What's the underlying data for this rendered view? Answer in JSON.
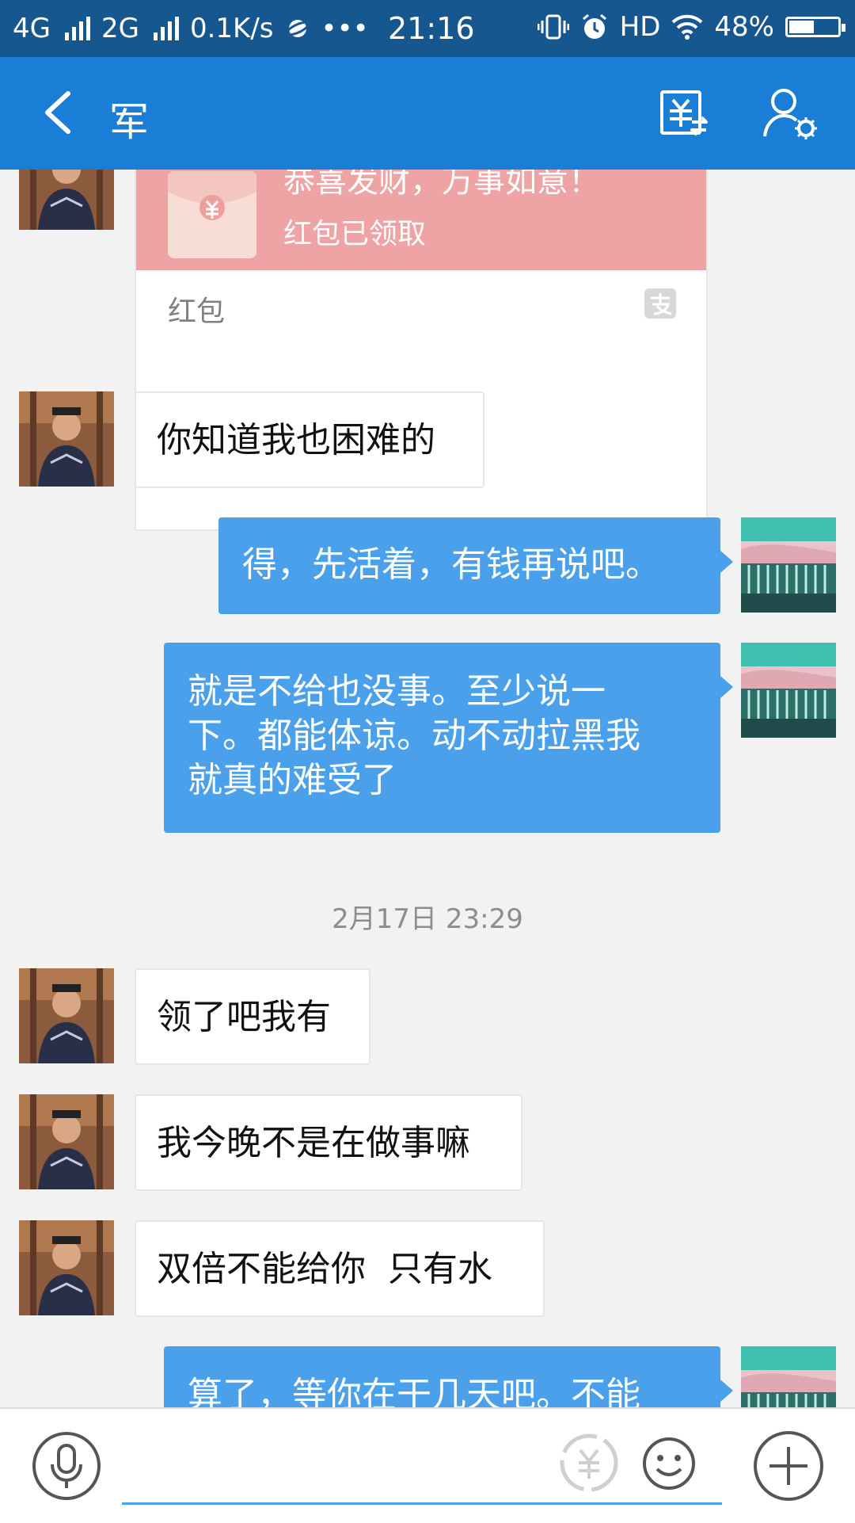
{
  "status_bar": {
    "network1": "4G",
    "network2": "2G",
    "speed": "0.1K/s",
    "more": "•••",
    "time": "21:16",
    "hd": "HD",
    "battery": "48%",
    "battery_level": 0.48
  },
  "header": {
    "title": "军",
    "back_icon": "chevron-left-icon",
    "transfer_icon": "transfer-yuan-icon",
    "profile_icon": "user-settings-icon"
  },
  "red_packet": {
    "greeting": "恭喜发财，万事如意！",
    "status": "红包已领取",
    "label": "红包",
    "envelope_icon": "red-envelope-yuan-icon",
    "alipay_icon": "alipay-icon"
  },
  "messages": [
    {
      "side": "in",
      "text": "你知道我也困难的"
    },
    {
      "side": "out",
      "text": "得，先活着，有钱再说吧。"
    },
    {
      "side": "out",
      "text": "就是不给也没事。至少说一\n下。都能体谅。动不动拉黑我\n就真的难受了"
    },
    {
      "side": "time",
      "text": "2月17日 23:29"
    },
    {
      "side": "in",
      "text": "领了吧我有"
    },
    {
      "side": "in",
      "text": "我今晚不是在做事嘛"
    },
    {
      "side": "in",
      "text": "双倍不能给你  只有水"
    },
    {
      "side": "out",
      "text": "算了，等你在干几天吧。不能"
    }
  ],
  "input_bar": {
    "voice_icon": "microphone-icon",
    "redpacket_icon": "yuan-icon",
    "emoji_icon": "smiley-icon",
    "more_icon": "plus-circle-icon"
  },
  "colors": {
    "header_bg": "#1a7ed6",
    "status_bg": "#17578f",
    "outgoing_bubble": "#4ba0ec",
    "incoming_bubble": "#ffffff",
    "red_packet": "#eea3a5",
    "chat_bg": "#f2f2f2"
  }
}
